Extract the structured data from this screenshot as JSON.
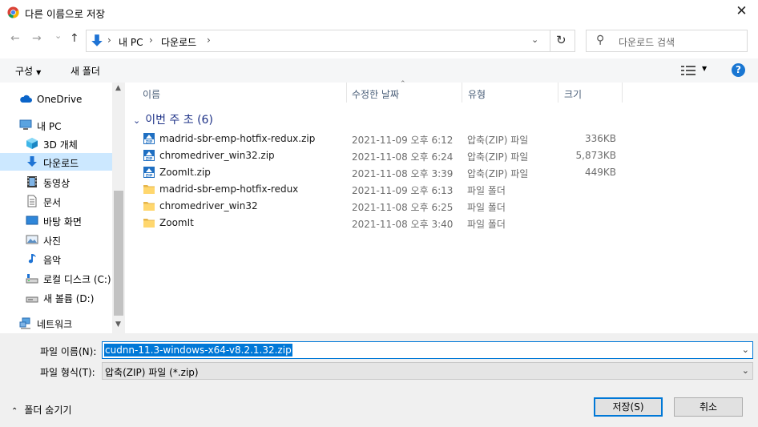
{
  "window": {
    "title": "다른 이름으로 저장",
    "close_glyph": "✕"
  },
  "nav": {
    "back_glyph": "←",
    "forward_glyph": "→",
    "recent_glyph": "⌄",
    "up_glyph": "↑"
  },
  "address": {
    "crumbs": [
      "내 PC",
      "다운로드"
    ],
    "separator": "›",
    "dropdown_glyph": "⌄",
    "refresh_glyph": "↻"
  },
  "search": {
    "placeholder": "다운로드 검색",
    "icon_glyph": "⚲"
  },
  "toolbar": {
    "organize": "구성",
    "new_folder": "새 폴더",
    "dropdown_glyph": "▼",
    "help": "?"
  },
  "sidebar": {
    "items": [
      {
        "label": "OneDrive",
        "icon": "cloud-icon"
      },
      {
        "label": "내 PC",
        "icon": "computer-icon"
      },
      {
        "label": "3D 개체",
        "icon": "cube-icon"
      },
      {
        "label": "다운로드",
        "icon": "download-icon",
        "selected": true
      },
      {
        "label": "동영상",
        "icon": "video-icon"
      },
      {
        "label": "문서",
        "icon": "document-icon"
      },
      {
        "label": "바탕 화면",
        "icon": "desktop-icon"
      },
      {
        "label": "사진",
        "icon": "picture-icon"
      },
      {
        "label": "음악",
        "icon": "music-icon"
      },
      {
        "label": "로컬 디스크 (C:)",
        "icon": "drive-icon"
      },
      {
        "label": "새 볼륨 (D:)",
        "icon": "drive-icon"
      },
      {
        "label": "네트워크",
        "icon": "network-icon"
      }
    ],
    "scroll_up": "▲",
    "scroll_down": "▼"
  },
  "columns": {
    "name": "이름",
    "date": "수정한 날짜",
    "type": "유형",
    "size": "크기",
    "sort_glyph": "⌃"
  },
  "group": {
    "label": "이번 주 초",
    "count": "(6)",
    "chevron": "⌄"
  },
  "files": [
    {
      "name": "madrid-sbr-emp-hotfix-redux.zip",
      "date": "2021-11-09 오후 6:12",
      "type": "압축(ZIP) 파일",
      "size": "336KB",
      "icon": "zip-icon"
    },
    {
      "name": "chromedriver_win32.zip",
      "date": "2021-11-08 오후 6:24",
      "type": "압축(ZIP) 파일",
      "size": "5,873KB",
      "icon": "zip-icon"
    },
    {
      "name": "ZoomIt.zip",
      "date": "2021-11-08 오후 3:39",
      "type": "압축(ZIP) 파일",
      "size": "449KB",
      "icon": "zip-icon"
    },
    {
      "name": "madrid-sbr-emp-hotfix-redux",
      "date": "2021-11-09 오후 6:13",
      "type": "파일 폴더",
      "size": "",
      "icon": "folder-icon"
    },
    {
      "name": "chromedriver_win32",
      "date": "2021-11-08 오후 6:25",
      "type": "파일 폴더",
      "size": "",
      "icon": "folder-icon"
    },
    {
      "name": "ZoomIt",
      "date": "2021-11-08 오후 3:40",
      "type": "파일 폴더",
      "size": "",
      "icon": "folder-icon"
    }
  ],
  "save": {
    "filename_label": "파일 이름(N):",
    "filename_value": "cudnn-11.3-windows-x64-v8.2.1.32.zip",
    "filetype_label": "파일 형식(T):",
    "filetype_value": "압축(ZIP) 파일 (*.zip)",
    "dropdown_glyph": "⌄",
    "hide_folders": "폴더 숨기기",
    "hide_caret": "⌃",
    "save_button": "저장(S)",
    "cancel_button": "취소"
  },
  "colors": {
    "accent": "#0078d7",
    "selected_bg": "#cce8ff",
    "group_header": "#1e3287",
    "help": "#1976d2"
  }
}
